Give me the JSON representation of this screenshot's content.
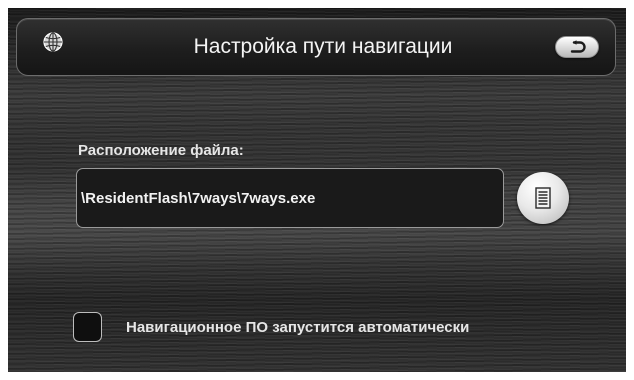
{
  "header": {
    "title": "Настройка пути навигации",
    "left_icon": "globe-icon",
    "back_icon": "back-arrow-icon"
  },
  "file_location": {
    "label": "Расположение файла:",
    "path_value": "\\ResidentFlash\\7ways\\7ways.exe",
    "browse_icon": "document-list-icon"
  },
  "autostart": {
    "checked": false,
    "label": "Навигационное ПО запустится автоматически"
  }
}
